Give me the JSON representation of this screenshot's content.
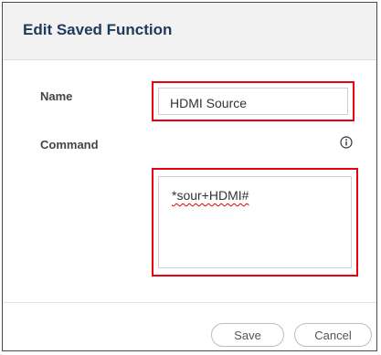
{
  "dialog": {
    "title": "Edit Saved Function",
    "name_label": "Name",
    "name_value": "HDMI Source",
    "command_label": "Command",
    "command_value": "*sour+HDMI#",
    "info_icon": "info-circle-icon",
    "save_label": "Save",
    "cancel_label": "Cancel"
  },
  "colors": {
    "title": "#1f3a5a",
    "highlight_border": "#e8000f",
    "header_bg": "#f2f2f2"
  }
}
